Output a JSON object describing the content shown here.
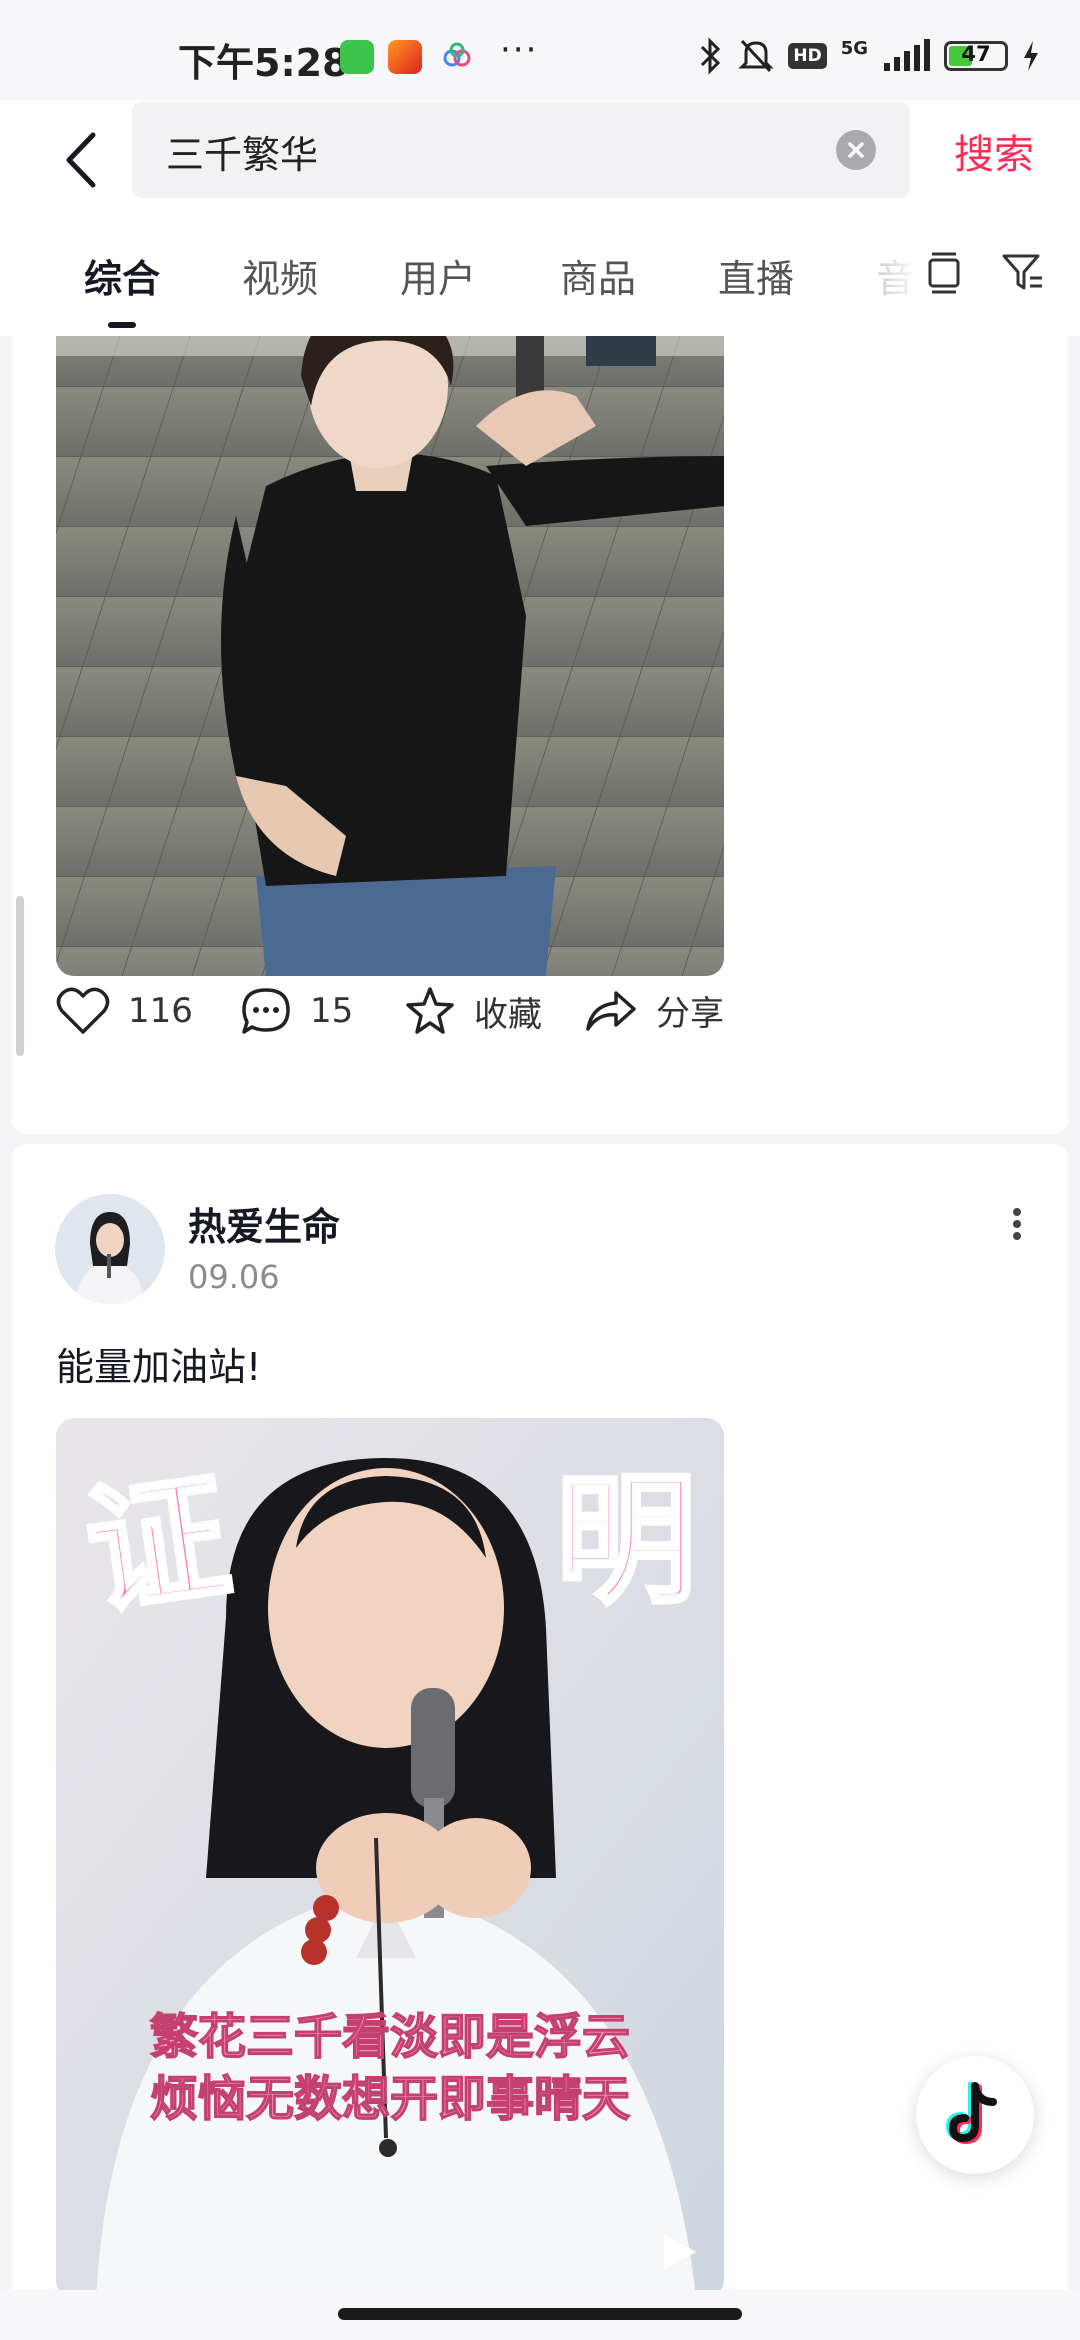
{
  "status_bar": {
    "time": "下午5:28",
    "app_icons": [
      "wechat-icon",
      "58-app-icon",
      "cloud-app-icon"
    ],
    "more": "···",
    "network": "5G",
    "hd": "HD",
    "battery_level": "47",
    "battery_fraction": 0.47
  },
  "search": {
    "query": "三千繁华",
    "button_label": "搜索",
    "accent": "#fe2c55"
  },
  "tabs": [
    {
      "label": "综合",
      "active": true
    },
    {
      "label": "视频",
      "active": false
    },
    {
      "label": "用户",
      "active": false
    },
    {
      "label": "商品",
      "active": false
    },
    {
      "label": "直播",
      "active": false
    },
    {
      "label": "音",
      "active": false
    }
  ],
  "post1": {
    "likes": "116",
    "comments": "15",
    "favorite_label": "收藏",
    "share_label": "分享"
  },
  "post2": {
    "author": "热爱生命",
    "date": "09.06",
    "caption": "能量加油站!",
    "overlay_title_left": "证",
    "overlay_title_right": "明",
    "overlay_line1": "繁花三千看淡即是浮云",
    "overlay_line2": "烦恼无数想开即事晴天"
  }
}
